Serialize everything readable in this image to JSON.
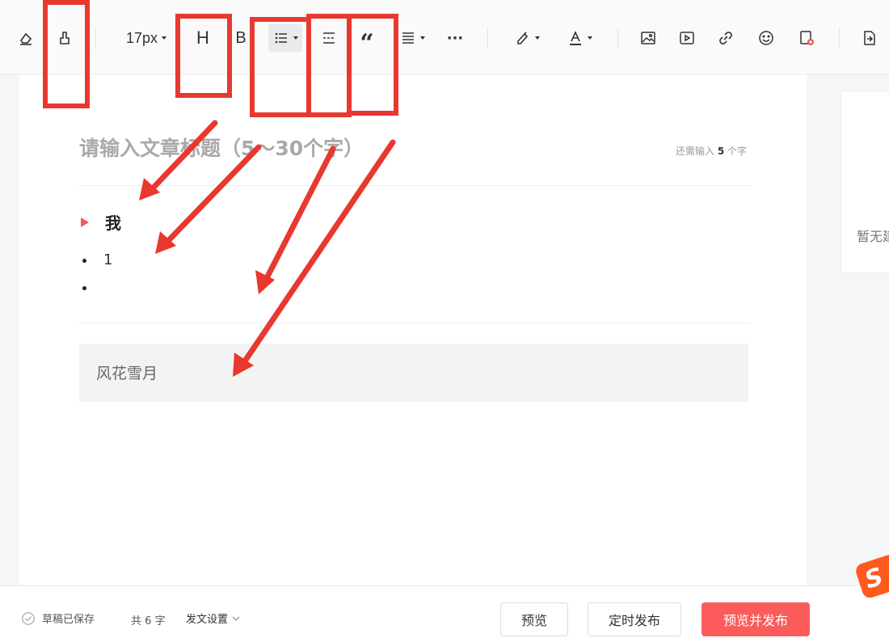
{
  "toolbar": {
    "font_size": "17px",
    "heading_label": "H",
    "bold_label": "B",
    "quote_label": "“",
    "more_label": "···",
    "icons": [
      "eraser-icon",
      "format-painter-icon",
      "font-size-dropdown",
      "heading-icon",
      "bold-icon",
      "bullet-list-icon",
      "divider-icon",
      "quote-icon",
      "align-icon",
      "more-icon",
      "highlight-icon",
      "font-color-icon",
      "image-icon",
      "video-icon",
      "link-icon",
      "emoji-icon",
      "template-icon",
      "import-icon"
    ]
  },
  "editor": {
    "title_placeholder": "请输入文章标题（5～30个字）",
    "word_hint_prefix": "还需输入 ",
    "word_hint_count": "5",
    "word_hint_suffix": " 个字",
    "heading_text": "我",
    "list_items": [
      "1",
      ""
    ],
    "quote_text": "风花雪月"
  },
  "side_panel": {
    "empty_text": "暂无建"
  },
  "bottom": {
    "saved_text": "草稿已保存",
    "count_text": "共 6 字",
    "settings_text": "发文设置",
    "preview_label": "预览",
    "schedule_label": "定时发布",
    "publish_label": "预览并发布"
  },
  "badge": {
    "text": "S"
  },
  "colors": {
    "accent": "#fc5b5b",
    "annotation": "#e8382f",
    "heading_marker": "#f25a5a"
  }
}
